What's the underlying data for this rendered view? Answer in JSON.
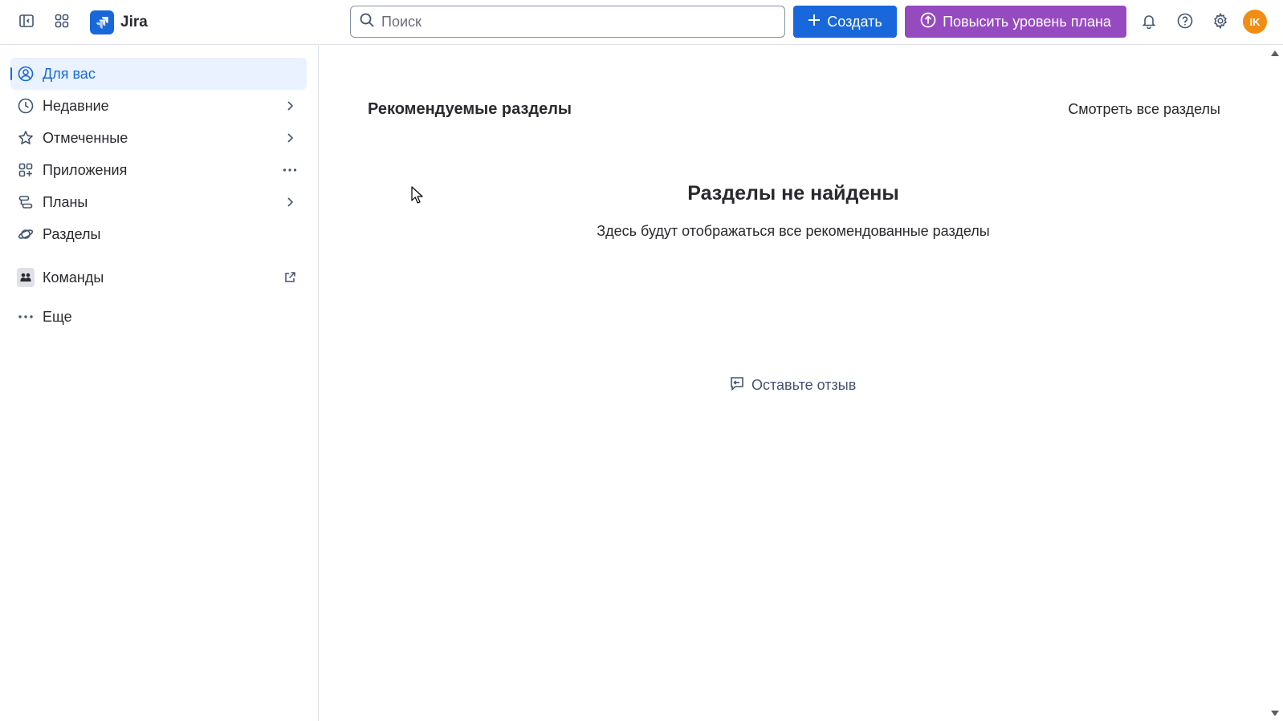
{
  "app": {
    "name": "Jira"
  },
  "search": {
    "placeholder": "Поиск",
    "value": ""
  },
  "header": {
    "create_label": "Создать",
    "upgrade_label": "Повысить уровень плана",
    "avatar_initials": "IK"
  },
  "sidebar": {
    "items": [
      {
        "label": "Для вас",
        "icon": "user-circle-icon",
        "active": true
      },
      {
        "label": "Недавние",
        "icon": "clock-icon",
        "right": "chevron-right-icon"
      },
      {
        "label": "Отмеченные",
        "icon": "star-icon",
        "right": "chevron-right-icon"
      },
      {
        "label": "Приложения",
        "icon": "apps-icon",
        "right": "more-icon"
      },
      {
        "label": "Планы",
        "icon": "plans-icon",
        "right": "chevron-right-icon"
      },
      {
        "label": "Разделы",
        "icon": "spaces-icon"
      },
      {
        "label": "Команды",
        "icon": "teams-icon",
        "right": "external-link-icon"
      },
      {
        "label": "Еще",
        "icon": "more-icon"
      }
    ]
  },
  "main": {
    "section_title": "Рекомендуемые разделы",
    "view_all": "Смотреть все разделы",
    "empty_title": "Разделы не найдены",
    "empty_subtitle": "Здесь будут отображаться все рекомендованные разделы",
    "feedback_label": "Оставьте отзыв"
  },
  "colors": {
    "primary": "#1868db",
    "upgrade": "#964ac0",
    "avatar": "#f18d13",
    "active_bg": "#e9f2fe"
  }
}
